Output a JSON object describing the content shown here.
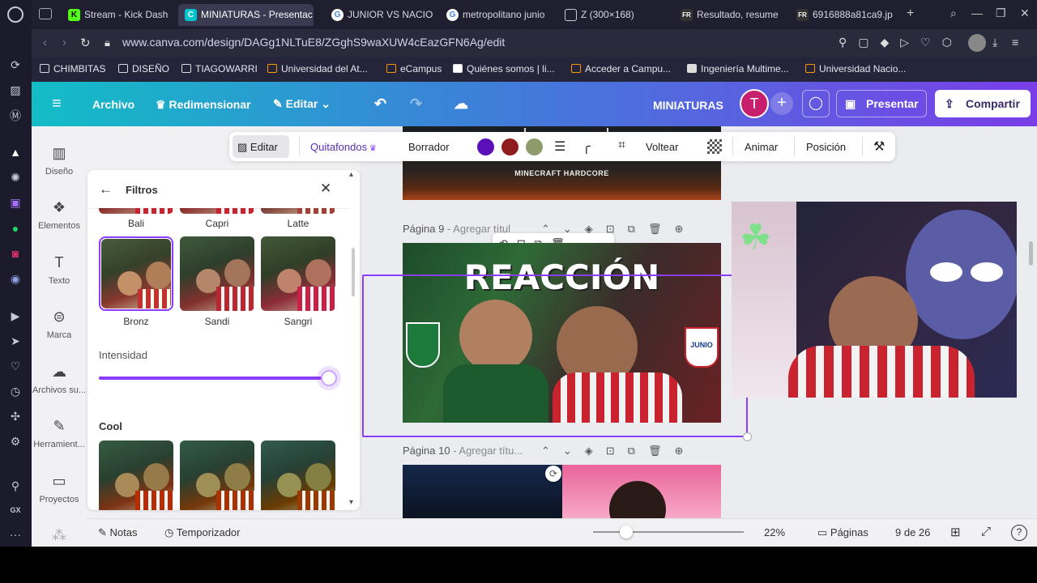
{
  "tabs": [
    {
      "label": "Stream - Kick Dash",
      "icon": "kick-icon"
    },
    {
      "label": "MINIATURAS - Presentac",
      "icon": "canva-icon"
    },
    {
      "label": "JUNIOR VS NACIO",
      "icon": "google-icon"
    },
    {
      "label": "metropolitano junio",
      "icon": "google-icon"
    },
    {
      "label": "Z (300×168)",
      "icon": "document-icon"
    },
    {
      "label": "Resultado, resume",
      "icon": "fr-icon"
    },
    {
      "label": "6916888a81ca9.jp",
      "icon": "fr-icon"
    }
  ],
  "address": {
    "url": "www.canva.com/design/DAGg1NLTuE8/ZGghS9waXUW4cEazGFN6Ag/edit"
  },
  "bookmarks": [
    "CHIMBITAS",
    "DISEÑO",
    "TIAGOWARRI",
    "Universidad del At...",
    "eCampus",
    "Quiénes somos | li...",
    "Acceder a Campu...",
    "Ingeniería Multime...",
    "Universidad Nacio..."
  ],
  "header": {
    "archivo": "Archivo",
    "redimensionar": "Redimensionar",
    "editar": "Editar",
    "title": "MINIATURAS",
    "avatar": "T",
    "presentar": "Presentar",
    "compartir": "Compartir",
    "brand_color": "#7d2ae8"
  },
  "sidebar": [
    {
      "label": "Diseño",
      "icon": "layout-icon"
    },
    {
      "label": "Elementos",
      "icon": "shapes-icon"
    },
    {
      "label": "Texto",
      "icon": "text-icon"
    },
    {
      "label": "Marca",
      "icon": "brand-icon"
    },
    {
      "label": "Archivos su...",
      "icon": "upload-icon"
    },
    {
      "label": "Herramient...",
      "icon": "tools-icon"
    },
    {
      "label": "Proyectos",
      "icon": "folder-icon"
    }
  ],
  "filters": {
    "title": "Filtros",
    "row_top": [
      "Bali",
      "Capri",
      "Latte"
    ],
    "row_mid": [
      "Bronz",
      "Sandi",
      "Sangri"
    ],
    "selected": "Bronz",
    "intensity_label": "Intensidad",
    "intensity_value": 100,
    "cool_label": "Cool"
  },
  "context_toolbar": {
    "editar": "Editar",
    "quitafondos": "Quitafondos",
    "borrador": "Borrador",
    "colors": [
      "#5b0fb8",
      "#8f1d1d",
      "#8f9a6a"
    ],
    "voltear": "Voltear",
    "animar": "Animar",
    "posicion": "Posición"
  },
  "pages": {
    "page8_caption": "MINECRAFT HARDCORE",
    "page9_label": "Página 9",
    "page9_sub": "- Agregar títul",
    "page9_headline": "REACCIÓN",
    "page9_badge": "JUNIO",
    "page10_label": "Página 10",
    "page10_sub": "- Agregar títu..."
  },
  "bottom": {
    "notas": "Notas",
    "temporizador": "Temporizador",
    "zoom": "22%",
    "paginas": "Páginas",
    "page_count": "9 de 26"
  }
}
